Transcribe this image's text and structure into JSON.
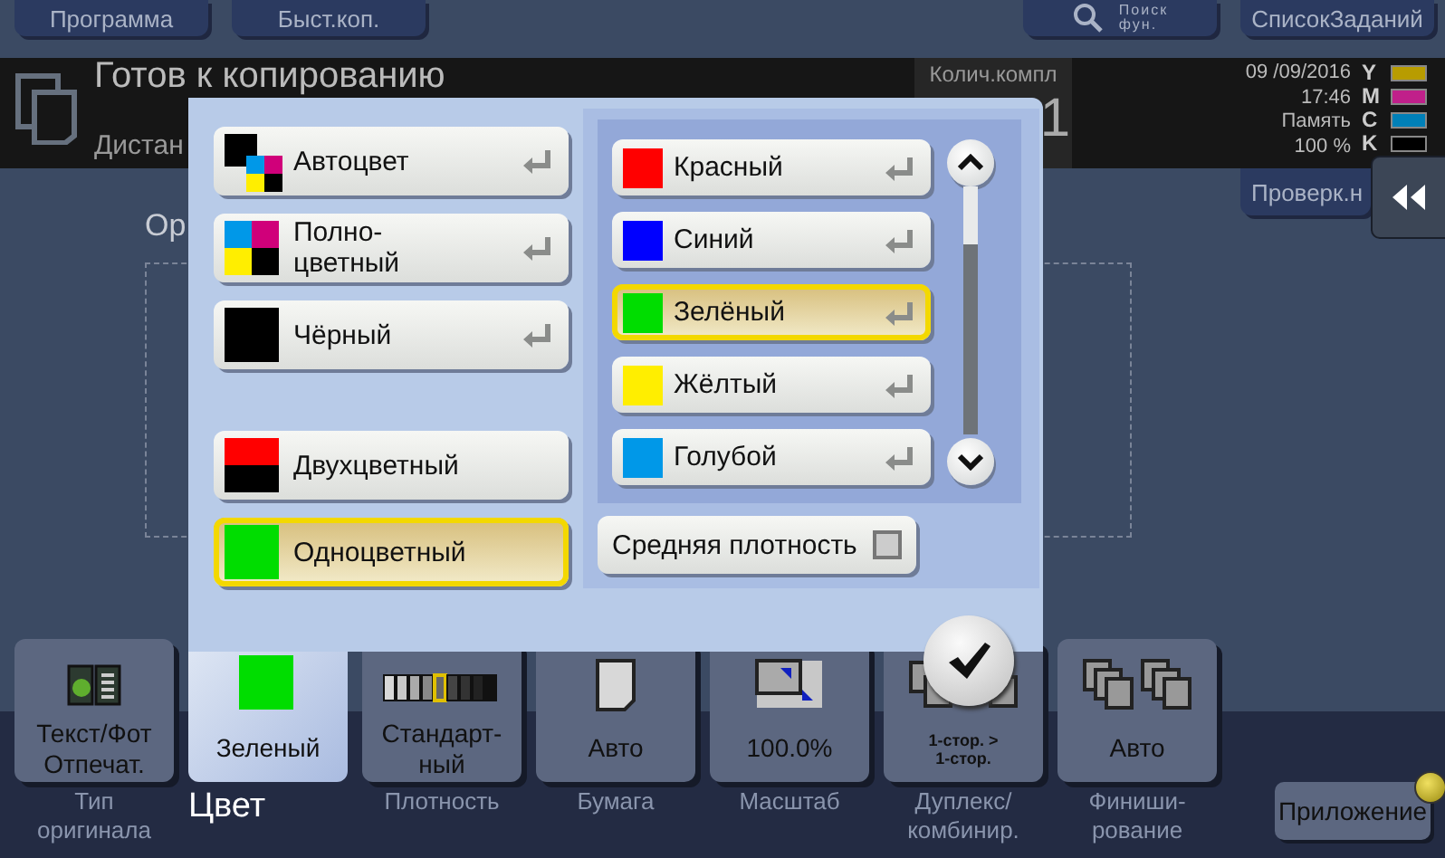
{
  "top_bar": {
    "buttons": [
      {
        "label": "Программа",
        "kind": "plain"
      },
      {
        "label": "Быст.коп.",
        "kind": "plain"
      },
      {
        "label": "Поиск\nфун.",
        "kind": "search"
      },
      {
        "label": "СписокЗаданий",
        "kind": "plain"
      }
    ]
  },
  "status": {
    "title": "Готов к копированию",
    "subtitle": "Дистан",
    "copies_label": "Колич.компл",
    "copies": "1",
    "date": "09 /09/2016",
    "time": "17:46",
    "memory_label": "Память",
    "memory": "100 %",
    "toners": [
      {
        "label": "Y",
        "color": "#b89c00"
      },
      {
        "label": "M",
        "color": "#c0208a"
      },
      {
        "label": "C",
        "color": "#0080b8"
      },
      {
        "label": "K",
        "color": "#000000"
      }
    ]
  },
  "main": {
    "section_label": "Ор",
    "check_button": "Проверк.н"
  },
  "popup": {
    "modes": [
      {
        "label": "Автоцвет",
        "kind": "auto",
        "arrow": true,
        "selected": false
      },
      {
        "label": "Полно-\nцветный",
        "kind": "full",
        "arrow": true,
        "selected": false
      },
      {
        "label": "Чёрный",
        "kind": "black",
        "arrow": true,
        "selected": false
      },
      {
        "label": "Двухцветный",
        "kind": "two",
        "arrow": false,
        "selected": false
      },
      {
        "label": "Одноцветный",
        "kind": "single",
        "arrow": false,
        "selected": true
      }
    ],
    "colors": [
      {
        "label": "Красный",
        "color": "#ff0000",
        "selected": false
      },
      {
        "label": "Синий",
        "color": "#0000ff",
        "selected": false
      },
      {
        "label": "Зелёный",
        "color": "#00dd00",
        "selected": true
      },
      {
        "label": "Жёлтый",
        "color": "#ffee00",
        "selected": false
      },
      {
        "label": "Голубой",
        "color": "#0098e8",
        "selected": false
      }
    ],
    "density": {
      "label": "Средняя плотность",
      "checked": false
    }
  },
  "tiles": [
    {
      "kind": "original_type",
      "value": "Текст/Фот\nОтпечат.",
      "label": "Тип\nоригинала",
      "selected": false
    },
    {
      "kind": "color",
      "value": "Зеленый",
      "label": "Цвет",
      "selected": true
    },
    {
      "kind": "density",
      "value": "Стандарт-\nный",
      "label": "Плотность",
      "selected": false
    },
    {
      "kind": "paper",
      "value": "Авто",
      "label": "Бумага",
      "selected": false
    },
    {
      "kind": "zoom",
      "value": "100.0%",
      "label": "Масштаб",
      "selected": false
    },
    {
      "kind": "duplex",
      "value": "1-стор. >\n1-стор.",
      "label": "Дуплекс/\nкомбинир.",
      "selected": false
    },
    {
      "kind": "finishing",
      "value": "Авто",
      "label": "Финиши-\nрование",
      "selected": false
    }
  ],
  "app_button": {
    "label": "Приложение"
  }
}
